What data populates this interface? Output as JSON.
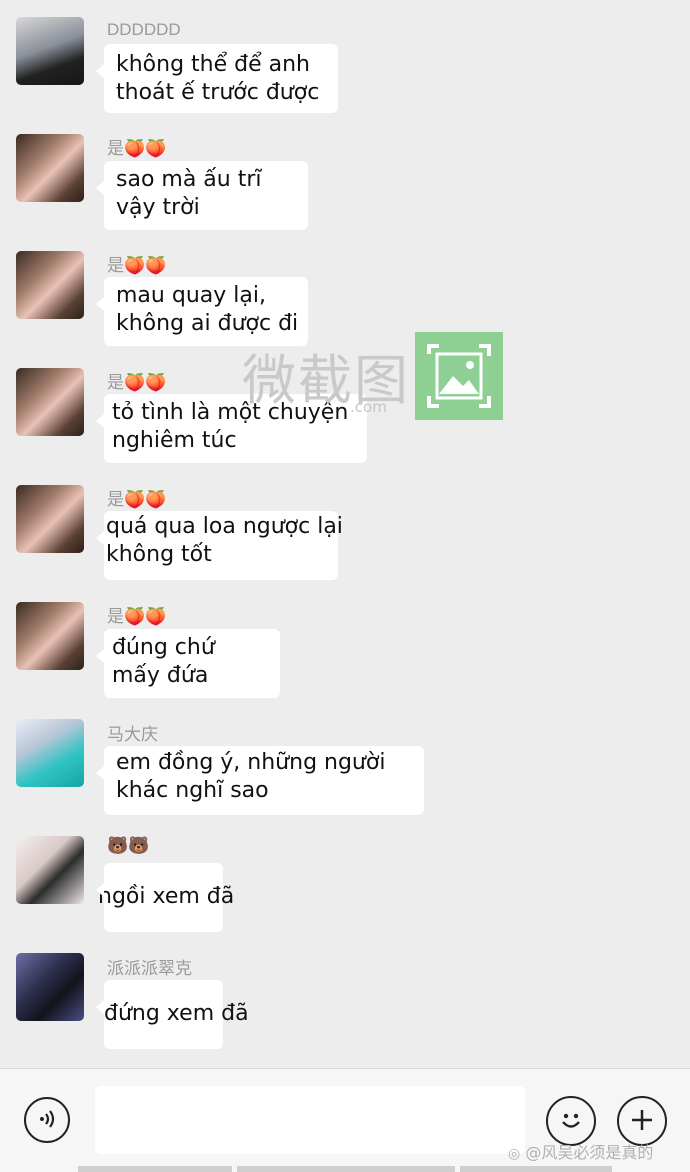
{
  "messages": [
    {
      "sender": "DDDDDD",
      "lines": [
        "không thể để anh",
        "thoát ế trước được"
      ]
    },
    {
      "sender": "是🍑🍑",
      "lines": [
        "sao mà ấu trĩ",
        "vậy trời"
      ]
    },
    {
      "sender": "是🍑🍑",
      "lines": [
        "mau quay lại,",
        "không ai được đi"
      ]
    },
    {
      "sender": "是🍑🍑",
      "lines": [
        "tỏ tình là một chuyện",
        "nghiêm túc"
      ]
    },
    {
      "sender": "是🍑🍑",
      "lines": [
        "quá qua loa ngược lại",
        "không tốt"
      ]
    },
    {
      "sender": "是🍑🍑",
      "lines": [
        "đúng chứ",
        "mấy đứa"
      ]
    },
    {
      "sender": "马大庆",
      "lines": [
        "em đồng ý, những người",
        "khác nghĩ sao"
      ]
    },
    {
      "sender": "🐻🐻",
      "lines": [
        "ngồi xem đã"
      ]
    },
    {
      "sender": "派派派翠克",
      "lines": [
        "đứng xem đã"
      ]
    }
  ],
  "watermark": {
    "text": "微截图",
    "domain": ".com"
  },
  "input": {
    "placeholder": ""
  },
  "credit": {
    "text": "@风吴必须是真的"
  },
  "colors": {
    "background": "#ededed",
    "bubble": "#ffffff",
    "watermark_green": "#8ecf93"
  }
}
